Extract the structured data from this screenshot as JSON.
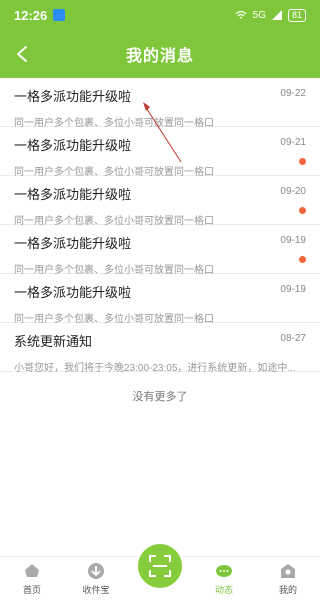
{
  "status": {
    "time": "12:26",
    "signal": "5G",
    "battery": "81"
  },
  "header": {
    "title": "我的消息"
  },
  "messages": [
    {
      "title": "一格多派功能升级啦",
      "date": "09-22",
      "preview": "同一用户多个包裹、多位小哥可放置同一格口",
      "unread": false
    },
    {
      "title": "一格多派功能升级啦",
      "date": "09-21",
      "preview": "同一用户多个包裹、多位小哥可放置同一格口",
      "unread": true
    },
    {
      "title": "一格多派功能升级啦",
      "date": "09-20",
      "preview": "同一用户多个包裹、多位小哥可放置同一格口",
      "unread": true
    },
    {
      "title": "一格多派功能升级啦",
      "date": "09-19",
      "preview": "同一用户多个包裹、多位小哥可放置同一格口",
      "unread": true
    },
    {
      "title": "一格多派功能升级啦",
      "date": "09-19",
      "preview": "同一用户多个包裹、多位小哥可放置同一格口",
      "unread": false
    },
    {
      "title": "系统更新通知",
      "date": "08-27",
      "preview": "小哥您好，我们将于今晚23:00-23:05，进行系统更新，如途中...",
      "unread": false
    }
  ],
  "footer_text": "没有更多了",
  "tabs": [
    {
      "label": "首页",
      "icon": "home-icon",
      "active": false
    },
    {
      "label": "收件宝",
      "icon": "download-icon",
      "active": false
    },
    {
      "label": "",
      "icon": "scan-icon",
      "active": false
    },
    {
      "label": "动态",
      "icon": "chat-icon",
      "active": true
    },
    {
      "label": "我的",
      "icon": "profile-icon",
      "active": false
    }
  ],
  "colors": {
    "brand": "#7ec63a",
    "unread_dot": "#f2643a",
    "annotation": "#c0392b"
  }
}
